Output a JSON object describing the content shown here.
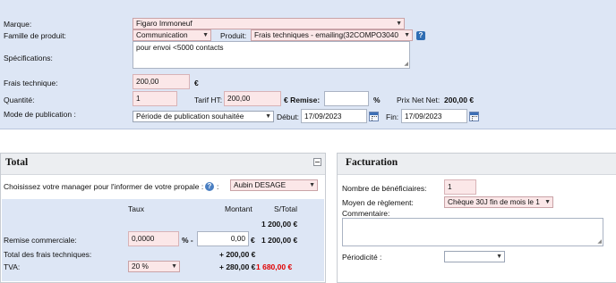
{
  "header": {
    "marque_label": "Marque:",
    "marque_value": "Figaro Immoneuf",
    "famille_label": "Famille de produit:",
    "famille_value": "Communication",
    "produit_label": "Produit:",
    "produit_value": "Frais techniques - emailing(32COMPO3040",
    "specifications_label": "Spécifications:",
    "specifications_value": "pour envoi <5000 contacts",
    "frais_label": "Frais technique:",
    "frais_value": "200,00",
    "frais_currency": "€",
    "quantite_label": "Quantité:",
    "quantite_value": "1",
    "tarif_label": "Tarif HT:",
    "tarif_value": "200,00",
    "remise_label": "€ Remise:",
    "remise_value": "",
    "percent": "%",
    "prix_net_label": "Prix Net Net:",
    "prix_net_value": "200,00 €",
    "mode_label": "Mode de publication :",
    "mode_value": "Période de publication souhaitée",
    "debut_label": "Début:",
    "debut_value": "17/09/2023",
    "fin_label": "Fin:",
    "fin_value": "17/09/2023"
  },
  "total": {
    "title": "Total",
    "manager_label": "Choisissez votre manager pour l'informer de votre propale :",
    "manager_suffix": ":",
    "manager_value": "Aubin DESAGE",
    "columns": {
      "taux": "Taux",
      "montant": "Montant",
      "stotal": "S/Total"
    },
    "first_stotal": "1 200,00 €",
    "remise_label": "Remise commerciale:",
    "remise_taux": "0,0000",
    "remise_percent": "% -",
    "remise_montant": "0,00",
    "remise_currency": "€",
    "remise_stotal": "1 200,00 €",
    "frais_label": "Total des frais techniques:",
    "frais_montant": "+ 200,00 €",
    "tva_label": "TVA:",
    "tva_value": "20 %",
    "tva_montant": "+ 280,00 €",
    "tva_stotal": "1 680,00 €"
  },
  "facturation": {
    "title": "Facturation",
    "beneficiaires_label": "Nombre de bénéficiaires:",
    "beneficiaires_value": "1",
    "reglement_label": "Moyen de règlement:",
    "reglement_value": "Chèque 30J fin de mois le 1",
    "commentaire_label": "Commentaire:",
    "commentaire_value": "",
    "periodicite_label": "Périodicité :",
    "periodicite_value": ""
  },
  "icons": {
    "help": "help-icon",
    "calendar": "calendar-icon",
    "dropdown": "chevron-down-icon",
    "minimize": "minimize-icon"
  },
  "colors": {
    "panel_bg": "#dde6f5",
    "required_field_bg": "#fbe7e8",
    "total_red": "#e00000"
  }
}
